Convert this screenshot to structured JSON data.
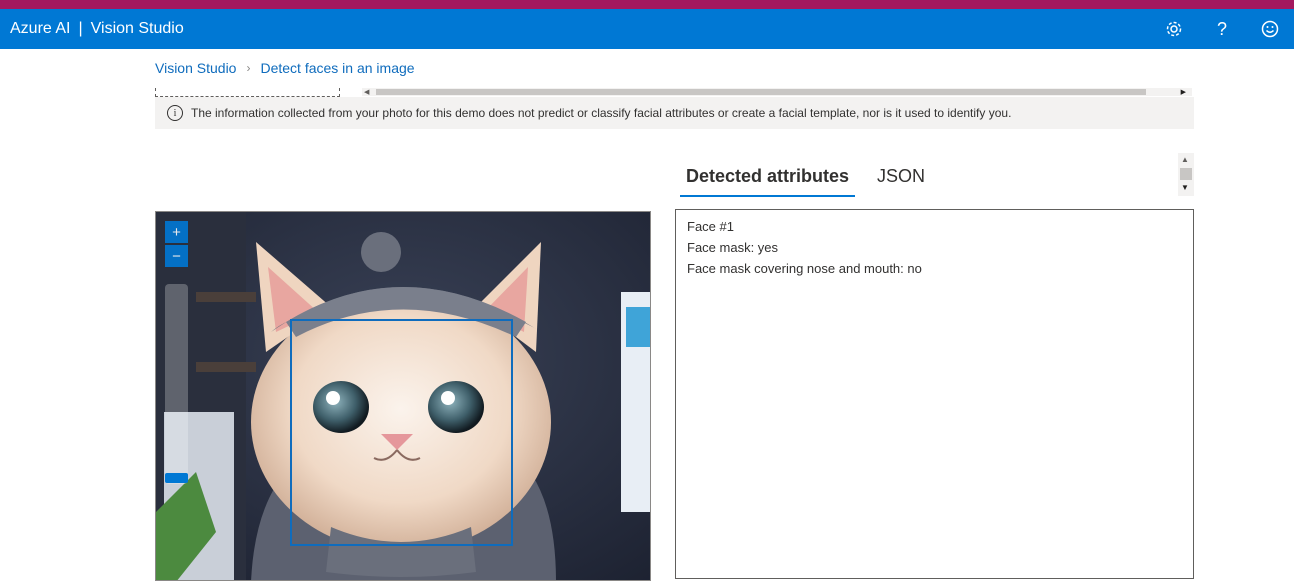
{
  "header": {
    "brand": "Azure AI",
    "separator": "|",
    "product": "Vision Studio",
    "icons": [
      "settings-icon",
      "help-icon",
      "feedback-smiley-icon"
    ]
  },
  "breadcrumb": {
    "home": "Vision Studio",
    "current": "Detect faces in an image"
  },
  "info_notice": "The information collected from your photo for this demo does not predict or classify facial attributes or create a facial template, nor is it used to identify you.",
  "tabs": [
    {
      "label": "Detected attributes",
      "active": true
    },
    {
      "label": "JSON",
      "active": false
    }
  ],
  "results": {
    "lines": [
      "Face #1",
      "Face mask: yes",
      "Face mask covering nose and mouth: no"
    ]
  },
  "image_viewer": {
    "zoom_in": "+",
    "zoom_out": "−"
  },
  "colors": {
    "header_bg": "#0078d4",
    "top_strip": "#a4185e",
    "accent": "#0078d4",
    "link": "#0f6cbd"
  }
}
